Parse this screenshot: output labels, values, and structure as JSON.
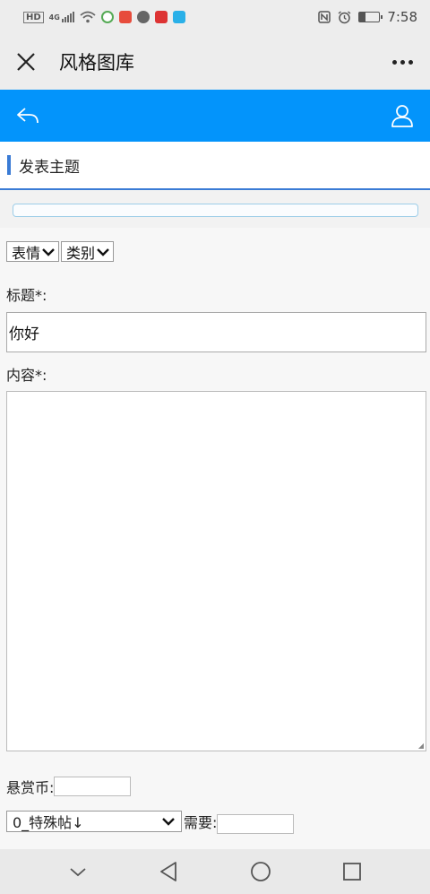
{
  "status_bar": {
    "network_hd": "HD",
    "network_type": "4G",
    "time": "7:58",
    "battery_percent": 30,
    "icons": [
      "hd-icon",
      "signal-icon",
      "wifi-icon",
      "app-icon-1",
      "app-icon-2",
      "app-icon-3",
      "app-icon-4",
      "app-icon-5",
      "nfc-icon",
      "alarm-icon",
      "battery-icon"
    ]
  },
  "title_bar": {
    "title": "风格图库"
  },
  "header": {
    "accent_color": "#0394fb",
    "left_icon": "back-reply-icon",
    "right_icon": "user-icon"
  },
  "section": {
    "title": "发表主题",
    "accent_color": "#3a7bd5"
  },
  "form": {
    "emoji_select": "表情",
    "category_select": "类别",
    "title_label": "标题*:",
    "title_value": "你好",
    "content_label": "内容*:",
    "content_value": "",
    "reward_label": "悬赏币:",
    "reward_value": "",
    "special_select": "0_特殊帖↓",
    "need_label": "需要:",
    "need_value": ""
  },
  "nav_bar": {
    "icons": [
      "nav-down-icon",
      "nav-back-icon",
      "nav-home-icon",
      "nav-recent-icon"
    ]
  }
}
